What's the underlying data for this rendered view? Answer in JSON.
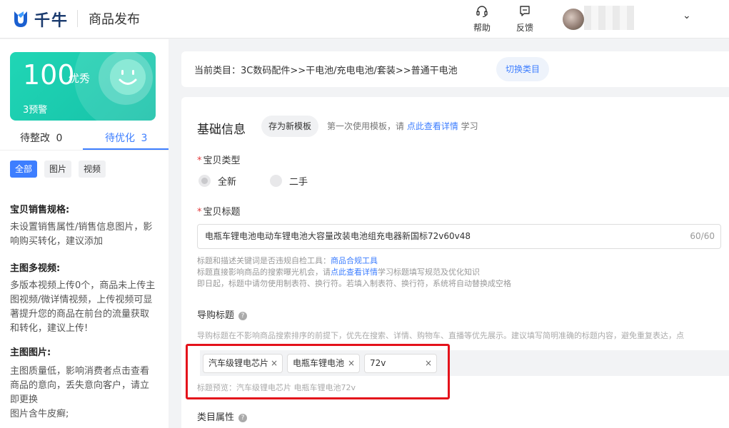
{
  "header": {
    "logo_text": "千牛",
    "page_title": "商品发布",
    "actions": [
      {
        "label": "帮助",
        "icon": "headset-icon"
      },
      {
        "label": "反馈",
        "icon": "feedback-icon"
      }
    ]
  },
  "sidebar": {
    "score": "100",
    "grade": "优秀",
    "warning": "3预警",
    "tabs": [
      {
        "label": "待整改",
        "count": "0"
      },
      {
        "label": "待优化",
        "count": "3"
      }
    ],
    "filters": [
      "全部",
      "图片",
      "视频"
    ],
    "sections": [
      {
        "title": "宝贝销售规格:",
        "body": "未设置销售属性/销售信息图片，影响购买转化，建议添加"
      },
      {
        "title": "主图多视频:",
        "body": "多版本视频上传0个，商品未上传主图视频/微详情视频，上传视频可显著提升您的商品在前台的流量获取和转化，建议上传!"
      },
      {
        "title": "主图图片:",
        "body": "主图质量低，影响消费者点击查看商品的意向，丢失意向客户，请立即更换\n图片含牛皮癣;"
      }
    ]
  },
  "category": {
    "text": "当前类目：3C数码配件>>干电池/充电电池/套装>>普通干电池",
    "switch_label": "切换类目"
  },
  "form": {
    "section_title": "基础信息",
    "template_button": "存为新模板",
    "template_tip_prefix": "第一次使用模板，请 ",
    "template_tip_link": "点此查看详情",
    "template_tip_suffix": " 学习",
    "type_label": "宝贝类型",
    "type_options": [
      "全新",
      "二手"
    ],
    "title_label": "宝贝标题",
    "title_value": "电瓶车锂电池电动车锂电池大容量改装电池组充电器新国标72v60v48",
    "title_count": "60/60",
    "help_1_prefix": "标题和描述关键词是否违规自检工具：",
    "help_1_link": "商品合规工具",
    "help_2_prefix": "标题直接影响商品的搜索曝光机会，请",
    "help_2_link": "点此查看详情",
    "help_2_suffix": "学习标题填写规范及优化知识",
    "help_3": "即日起，标题中请勿使用制表符、换行符。若填入制表符、换行符，系统将自动替换成空格",
    "guide_label": "导购标题",
    "guide_tip": "导购标题在不影响商品搜索排序的前提下，优先在搜索、详情、购物车、直播等优先展示。建议填写简明准确的标题内容，避免重复表达，点",
    "guide_tags": [
      "汽车级锂电芯片",
      "电瓶车锂电池",
      "72v"
    ],
    "guide_preview": "标题预览：汽车级锂电芯片 电瓶车锂电池72v",
    "attr_label": "类目属性"
  },
  "colors": {
    "accent": "#3d7eff",
    "score_card": "#20d6b5",
    "highlight_frame": "#e4121b"
  }
}
